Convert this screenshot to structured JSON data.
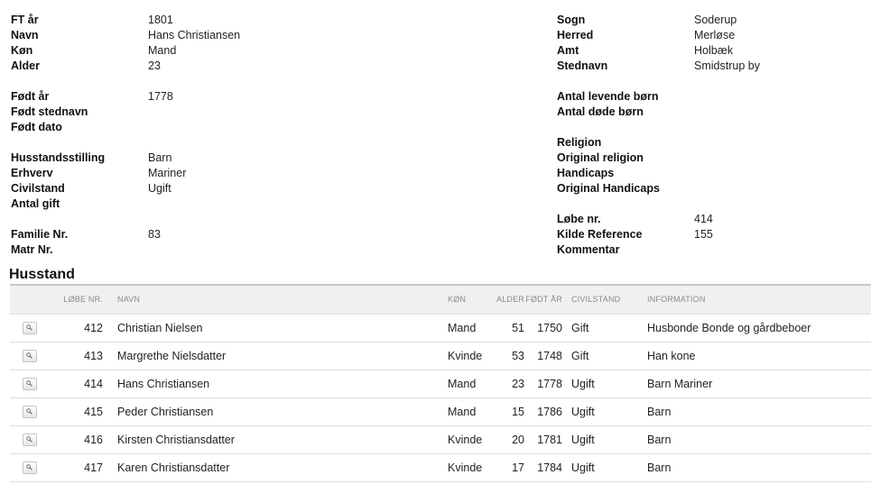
{
  "person": {
    "left": [
      {
        "label": "FT år",
        "value": "1801"
      },
      {
        "label": "Navn",
        "value": "Hans Christiansen"
      },
      {
        "label": "Køn",
        "value": "Mand"
      },
      {
        "label": "Alder",
        "value": "23"
      },
      {
        "label": "Født år",
        "value": "1778"
      },
      {
        "label": "Født stednavn",
        "value": ""
      },
      {
        "label": "Født dato",
        "value": ""
      },
      {
        "label": "Husstandsstilling",
        "value": "Barn"
      },
      {
        "label": "Erhverv",
        "value": "Mariner"
      },
      {
        "label": "Civilstand",
        "value": "Ugift"
      },
      {
        "label": "Antal gift",
        "value": ""
      },
      {
        "label": "Familie Nr.",
        "value": "83"
      },
      {
        "label": "Matr Nr.",
        "value": ""
      }
    ],
    "right": [
      {
        "label": "Sogn",
        "value": "Soderup"
      },
      {
        "label": "Herred",
        "value": "Merløse"
      },
      {
        "label": "Amt",
        "value": "Holbæk"
      },
      {
        "label": "Stednavn",
        "value": "Smidstrup by"
      },
      {
        "label": "Antal levende børn",
        "value": ""
      },
      {
        "label": "Antal døde børn",
        "value": ""
      },
      {
        "label": "Religion",
        "value": ""
      },
      {
        "label": "Original religion",
        "value": ""
      },
      {
        "label": "Handicaps",
        "value": ""
      },
      {
        "label": "Original Handicaps",
        "value": ""
      },
      {
        "label": "Løbe nr.",
        "value": "414"
      },
      {
        "label": "Kilde Reference",
        "value": "155"
      },
      {
        "label": "Kommentar",
        "value": ""
      }
    ]
  },
  "household": {
    "title": "Husstand",
    "columns": {
      "lobe_nr": "LØBE NR.",
      "navn": "NAVN",
      "kon": "KØN",
      "alder": "ALDER",
      "fodt_ar": "FØDT ÅR",
      "civilstand": "CIVILSTAND",
      "information": "INFORMATION"
    },
    "rows": [
      {
        "lobe_nr": "412",
        "navn": "Christian Nielsen",
        "kon": "Mand",
        "alder": "51",
        "fodt_ar": "1750",
        "civilstand": "Gift",
        "information": "Husbonde Bonde og gårdbeboer"
      },
      {
        "lobe_nr": "413",
        "navn": "Margrethe Nielsdatter",
        "kon": "Kvinde",
        "alder": "53",
        "fodt_ar": "1748",
        "civilstand": "Gift",
        "information": "Han kone"
      },
      {
        "lobe_nr": "414",
        "navn": "Hans Christiansen",
        "kon": "Mand",
        "alder": "23",
        "fodt_ar": "1778",
        "civilstand": "Ugift",
        "information": "Barn Mariner"
      },
      {
        "lobe_nr": "415",
        "navn": "Peder Christiansen",
        "kon": "Mand",
        "alder": "15",
        "fodt_ar": "1786",
        "civilstand": "Ugift",
        "information": "Barn"
      },
      {
        "lobe_nr": "416",
        "navn": "Kirsten Christiansdatter",
        "kon": "Kvinde",
        "alder": "20",
        "fodt_ar": "1781",
        "civilstand": "Ugift",
        "information": "Barn"
      },
      {
        "lobe_nr": "417",
        "navn": "Karen Christiansdatter",
        "kon": "Kvinde",
        "alder": "17",
        "fodt_ar": "1784",
        "civilstand": "Ugift",
        "information": "Barn"
      }
    ]
  },
  "icons": {
    "view": "magnifier-icon"
  }
}
